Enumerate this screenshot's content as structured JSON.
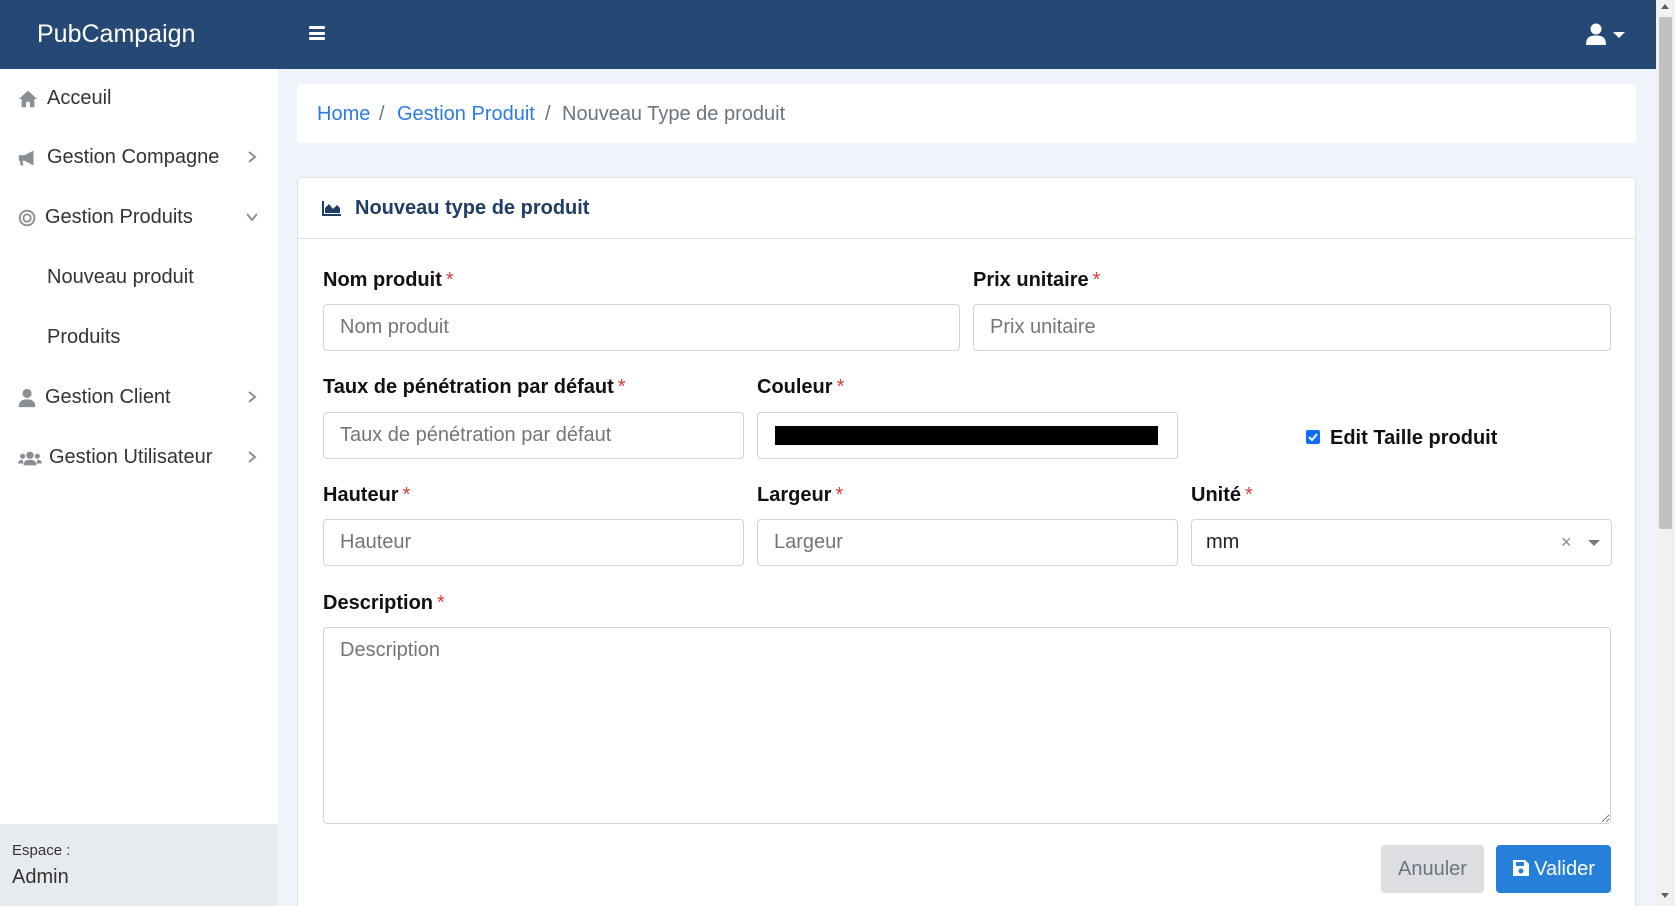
{
  "app": {
    "brand": "PubCampaign"
  },
  "colors": {
    "navbar": "#264875",
    "link": "#2c7be5",
    "primary_button": "#2680d9",
    "required": "#e03b3b",
    "color_value": "#000000"
  },
  "sidebar": {
    "items": [
      {
        "label": "Acceuil",
        "icon": "home-icon"
      },
      {
        "label": "Gestion Compagne",
        "icon": "bullhorn-icon"
      },
      {
        "label": "Gestion Produits",
        "icon": "bullseye-icon"
      },
      {
        "label": "Nouveau produit"
      },
      {
        "label": "Produits"
      },
      {
        "label": "Gestion Client",
        "icon": "user-icon"
      },
      {
        "label": "Gestion Utilisateur",
        "icon": "users-icon"
      }
    ],
    "espace_label": "Espace :",
    "espace_value": "Admin"
  },
  "breadcrumb": {
    "home": "Home",
    "section": "Gestion Produit",
    "current": "Nouveau Type de produit",
    "separator": "/"
  },
  "card": {
    "title": "Nouveau type de produit",
    "icon": "chart-area-icon"
  },
  "form": {
    "required_mark": "*",
    "nom_produit": {
      "label": "Nom produit",
      "placeholder": "Nom produit",
      "value": ""
    },
    "prix_unitaire": {
      "label": "Prix unitaire",
      "placeholder": "Prix unitaire",
      "value": ""
    },
    "taux": {
      "label": "Taux de pénétration par défaut",
      "placeholder": "Taux de pénétration par défaut",
      "value": ""
    },
    "couleur": {
      "label": "Couleur",
      "value": "#000000"
    },
    "edit_taille": {
      "label": "Edit Taille produit",
      "checked": true
    },
    "hauteur": {
      "label": "Hauteur",
      "placeholder": "Hauteur",
      "value": ""
    },
    "largeur": {
      "label": "Largeur",
      "placeholder": "Largeur",
      "value": ""
    },
    "unite": {
      "label": "Unité",
      "value": "mm",
      "clear": "×"
    },
    "description": {
      "label": "Description",
      "placeholder": "Description",
      "value": ""
    }
  },
  "buttons": {
    "cancel": "Anuuler",
    "save": "Valider"
  }
}
